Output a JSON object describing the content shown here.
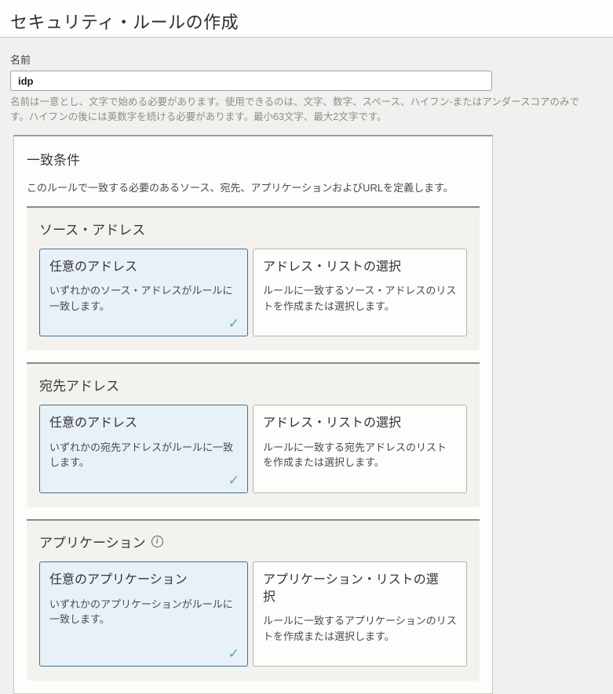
{
  "page": {
    "title": "セキュリティ・ルールの作成"
  },
  "name_field": {
    "label": "名前",
    "value": "idp",
    "helper": "名前は一意とし、文字で始める必要があります。使用できるのは、文字、数字、スペース、ハイフン-またはアンダースコアのみです。ハイフンの後には英数字を続ける必要があります。最小63文字、最大2文字です。"
  },
  "match_section": {
    "title": "一致条件",
    "description": "このルールで一致する必要のあるソース、宛先、アプリケーションおよびURLを定義します。",
    "groups": [
      {
        "heading": "ソース・アドレス",
        "selected": {
          "title": "任意のアドレス",
          "body": "いずれかのソース・アドレスがルールに一致します。"
        },
        "alternative": {
          "title": "アドレス・リストの選択",
          "body": "ルールに一致するソース・アドレスのリストを作成または選択します。"
        }
      },
      {
        "heading": "宛先アドレス",
        "selected": {
          "title": "任意のアドレス",
          "body": "いずれかの宛先アドレスがルールに一致します。"
        },
        "alternative": {
          "title": "アドレス・リストの選択",
          "body": "ルールに一致する宛先アドレスのリストを作成または選択します。"
        }
      },
      {
        "heading": "アプリケーション",
        "selected": {
          "title": "任意のアプリケーション",
          "body": "いずれかのアプリケーションがルールに一致します。"
        },
        "alternative": {
          "title": "アプリケーション・リストの選択",
          "body": "ルールに一致するアプリケーションのリストを作成または選択します。"
        }
      }
    ]
  },
  "icons": {
    "check": "✓",
    "info": "i"
  },
  "colors": {
    "page_background": "#f1f0ee",
    "selected_card_background": "#e8f1f8",
    "selected_card_border": "#44708e",
    "check": "#5b9dc0",
    "group_top_border": "#8d8b88"
  }
}
